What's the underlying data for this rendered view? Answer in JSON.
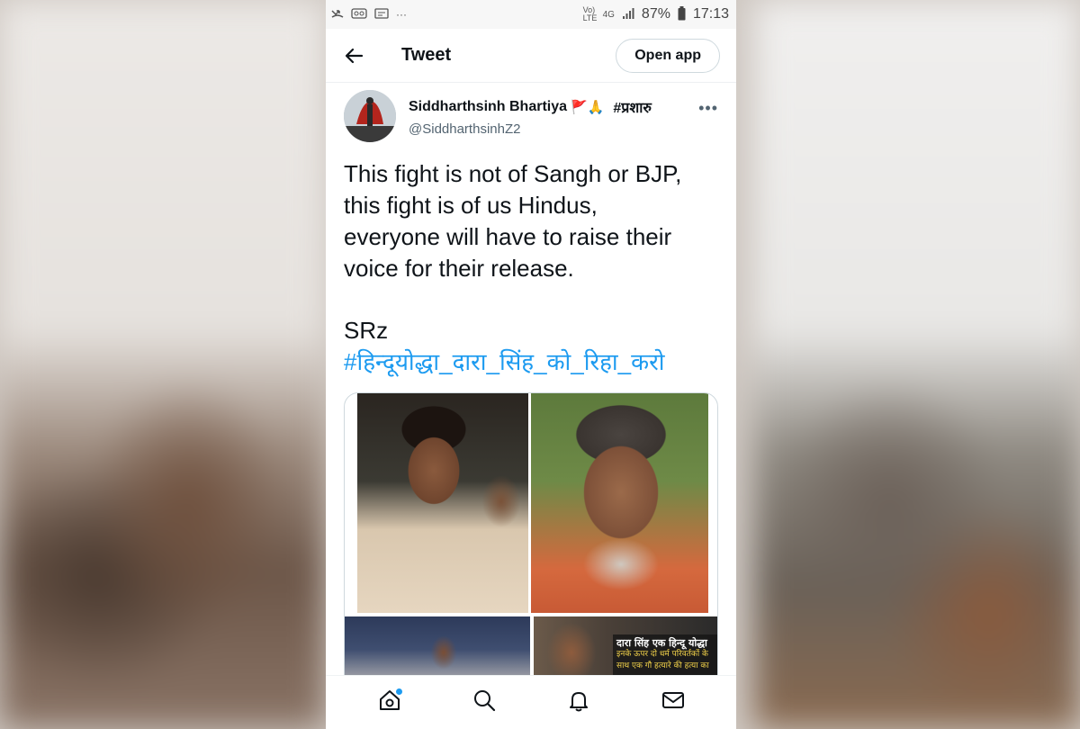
{
  "status_bar": {
    "left_icons": [
      "missed-call-icon",
      "voicemail-icon",
      "screen-icon",
      "more-dots-icon"
    ],
    "more": "···",
    "network": "Vo) LTE",
    "net_type": "4G",
    "battery": "87%",
    "time": "17:13"
  },
  "header": {
    "title": "Tweet",
    "open_app_label": "Open app"
  },
  "tweet": {
    "author_name": "Siddharthsinh Bhartiya",
    "author_emoji": "🚩🙏",
    "author_tag": "#प्रशारु",
    "author_handle": "@SiddharthsinhZ2",
    "body_lines": [
      "This fight is not of Sangh or BJP,",
      "this fight is of us Hindus,",
      "everyone will have to raise their",
      "voice for their release."
    ],
    "signature": "SRz",
    "hashtag": "#हिन्दूयोद्धा_दारा_सिंह_को_रिहा_करो",
    "media_caption_title": "दारा सिंह एक हिन्दू योद्धा",
    "media_caption_sub": "इनके ऊपर दो धर्म परिवर्तकों के साथ एक गौ हत्यारे की हत्या का"
  },
  "bottom_nav": [
    "home-icon",
    "search-icon",
    "notifications-icon",
    "messages-icon"
  ],
  "colors": {
    "accent": "#1d9bf0",
    "text": "#0f1419",
    "muted": "#536471"
  }
}
